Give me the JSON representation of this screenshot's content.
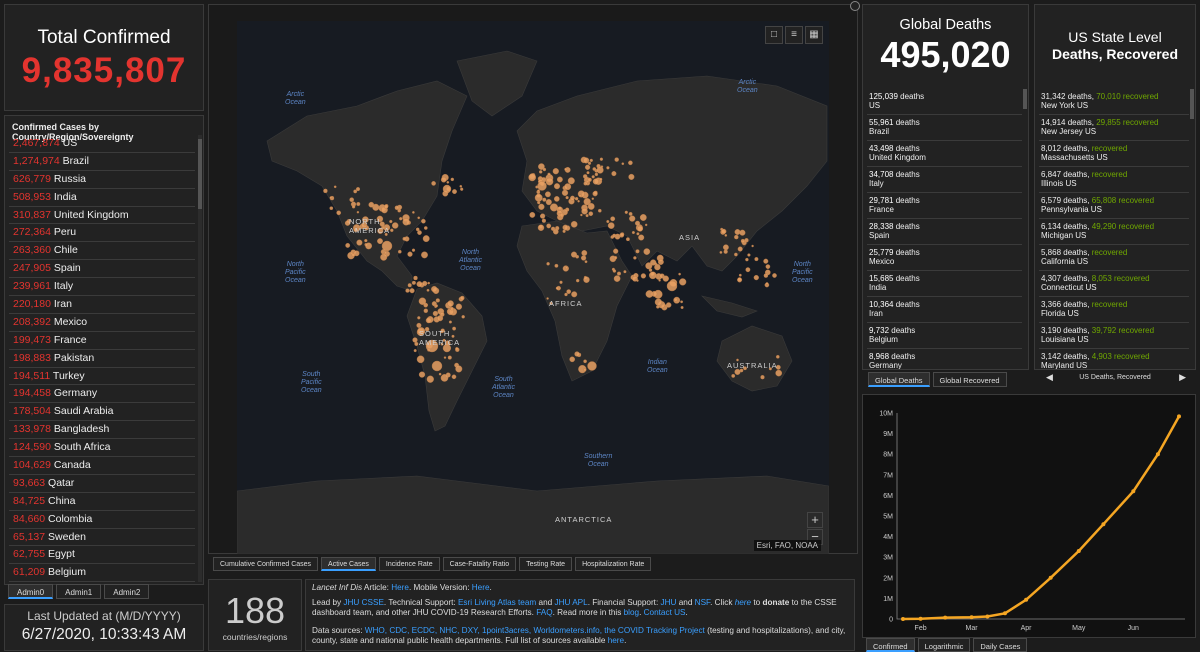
{
  "total": {
    "label": "Total Confirmed",
    "value": "9,835,807"
  },
  "countries": {
    "header": "Confirmed Cases by Country/Region/Sovereignty",
    "items": [
      {
        "count": "2,467,874",
        "name": "US"
      },
      {
        "count": "1,274,974",
        "name": "Brazil"
      },
      {
        "count": "626,779",
        "name": "Russia"
      },
      {
        "count": "508,953",
        "name": "India"
      },
      {
        "count": "310,837",
        "name": "United Kingdom"
      },
      {
        "count": "272,364",
        "name": "Peru"
      },
      {
        "count": "263,360",
        "name": "Chile"
      },
      {
        "count": "247,905",
        "name": "Spain"
      },
      {
        "count": "239,961",
        "name": "Italy"
      },
      {
        "count": "220,180",
        "name": "Iran"
      },
      {
        "count": "208,392",
        "name": "Mexico"
      },
      {
        "count": "199,473",
        "name": "France"
      },
      {
        "count": "198,883",
        "name": "Pakistan"
      },
      {
        "count": "194,511",
        "name": "Turkey"
      },
      {
        "count": "194,458",
        "name": "Germany"
      },
      {
        "count": "178,504",
        "name": "Saudi Arabia"
      },
      {
        "count": "133,978",
        "name": "Bangladesh"
      },
      {
        "count": "124,590",
        "name": "South Africa"
      },
      {
        "count": "104,629",
        "name": "Canada"
      },
      {
        "count": "93,663",
        "name": "Qatar"
      },
      {
        "count": "84,725",
        "name": "China"
      },
      {
        "count": "84,660",
        "name": "Colombia"
      },
      {
        "count": "65,137",
        "name": "Sweden"
      },
      {
        "count": "62,755",
        "name": "Egypt"
      },
      {
        "count": "61,209",
        "name": "Belgium"
      }
    ]
  },
  "admin_tabs": [
    "Admin0",
    "Admin1",
    "Admin2"
  ],
  "updated": {
    "label": "Last Updated at (M/D/YYYY)",
    "value": "6/27/2020, 10:33:43 AM"
  },
  "map": {
    "oceans": [
      {
        "text": "Arctic\nOcean"
      },
      {
        "text": "Arctic\nOcean"
      },
      {
        "text": "North\nPacific\nOcean"
      },
      {
        "text": "North\nAtlantic\nOcean"
      },
      {
        "text": "North\nPacific\nOcean"
      },
      {
        "text": "South\nPacific\nOcean"
      },
      {
        "text": "South\nAtlantic\nOcean"
      },
      {
        "text": "Indian\nOcean"
      },
      {
        "text": "Southern\nOcean"
      }
    ],
    "continents": [
      "NORTH\nAMERICA",
      "SOUTH\nAMERICA",
      "AFRICA",
      "ASIA",
      "AUSTRALIA",
      "ANTARCTICA"
    ],
    "attribution": "Esri, FAO, NOAA",
    "zoom_in": "+",
    "zoom_out": "−"
  },
  "map_tabs": [
    "Cumulative Confirmed Cases",
    "Active Cases",
    "Incidence Rate",
    "Case-Fatality Ratio",
    "Testing Rate",
    "Hospitalization Rate"
  ],
  "regions": {
    "value": "188",
    "label": "countries/regions"
  },
  "info": {
    "l1a": "Lancet Inf Dis",
    "l1b": " Article: ",
    "l1c": "Here",
    "l1d": ". Mobile Version: ",
    "l1e": "Here",
    "l1f": ".",
    "l2a": "Lead by ",
    "l2b": "JHU CSSE",
    "l2c": ". Technical Support: ",
    "l2d": "Esri Living Atlas team",
    "l2e": " and ",
    "l2f": "JHU APL",
    "l2g": ". Financial Support: ",
    "l2h": "JHU",
    "l2i": " and ",
    "l2j": "NSF",
    "l2k": ". Click ",
    "l2l": "here",
    "l2m": " to ",
    "l2n": "donate",
    "l2o": " to the CSSE dashboard team, and other JHU COVID-19 Research Efforts. ",
    "l2p": "FAQ",
    "l2q": ". Read more in this ",
    "l2r": "blog",
    "l2s": ". ",
    "l2t": "Contact US",
    "l2u": ".",
    "l3a": "Data sources: ",
    "l3b": "WHO, CDC, ECDC, NHC, DXY, 1point3acres, Worldometers.info, the COVID Tracking Project",
    "l3c": " (testing and hospitalizations), and city, county, state and national public health departments. Full list of sources available ",
    "l3d": "here",
    "l3e": "."
  },
  "global_deaths": {
    "label": "Global Deaths",
    "value": "495,020",
    "unit": "deaths",
    "items": [
      {
        "count": "125,039",
        "name": "US"
      },
      {
        "count": "55,961",
        "name": "Brazil"
      },
      {
        "count": "43,498",
        "name": "United Kingdom"
      },
      {
        "count": "34,708",
        "name": "Italy"
      },
      {
        "count": "29,781",
        "name": "France"
      },
      {
        "count": "28,338",
        "name": "Spain"
      },
      {
        "count": "25,779",
        "name": "Mexico"
      },
      {
        "count": "15,685",
        "name": "India"
      },
      {
        "count": "10,364",
        "name": "Iran"
      },
      {
        "count": "9,732",
        "name": "Belgium"
      },
      {
        "count": "8,968",
        "name": "Germany"
      }
    ]
  },
  "deaths_tabs": [
    "Global Deaths",
    "Global Recovered"
  ],
  "us_state": {
    "title1": "US State Level",
    "title2": "Deaths, Recovered",
    "deaths_word": "deaths,",
    "recovered_word": "recovered",
    "items": [
      {
        "deaths": "31,342",
        "recovered": "70,010",
        "name": "New York US"
      },
      {
        "deaths": "14,914",
        "recovered": "29,855",
        "name": "New Jersey US"
      },
      {
        "deaths": "8,012",
        "recovered": "",
        "name": "Massachusetts US"
      },
      {
        "deaths": "6,847",
        "recovered": "",
        "name": "Illinois US"
      },
      {
        "deaths": "6,579",
        "recovered": "65,808",
        "name": "Pennsylvania US"
      },
      {
        "deaths": "6,134",
        "recovered": "49,290",
        "name": "Michigan US"
      },
      {
        "deaths": "5,868",
        "recovered": "",
        "name": "California US"
      },
      {
        "deaths": "4,307",
        "recovered": "8,053",
        "name": "Connecticut US"
      },
      {
        "deaths": "3,366",
        "recovered": "",
        "name": "Florida US"
      },
      {
        "deaths": "3,190",
        "recovered": "39,792",
        "name": "Louisiana US"
      },
      {
        "deaths": "3,142",
        "recovered": "4,903",
        "name": "Maryland US"
      }
    ],
    "nav_label": "US Deaths, Recovered",
    "prev": "◀",
    "next": "▶"
  },
  "chart_tabs": [
    "Confirmed",
    "Logarithmic",
    "Daily Cases"
  ],
  "colors": {
    "confirmed_red": "#e3342f",
    "recovered_green": "#70a800",
    "link_blue": "#3a9fff",
    "bubble_orange": "#e8a063",
    "curve_orange": "#f5a623"
  },
  "chart_data": {
    "type": "line",
    "title": "",
    "xlabel": "",
    "ylabel": "",
    "x_ticks": [
      "Feb",
      "Mar",
      "Apr",
      "May",
      "Jun"
    ],
    "y_ticks": [
      "0",
      "1M",
      "2M",
      "3M",
      "4M",
      "5M",
      "6M",
      "7M",
      "8M",
      "9M",
      "10M"
    ],
    "ylim": [
      0,
      10000000
    ],
    "x": [
      "Jan 22",
      "Feb 1",
      "Feb 15",
      "Mar 1",
      "Mar 10",
      "Mar 20",
      "Apr 1",
      "Apr 15",
      "May 1",
      "May 15",
      "Jun 1",
      "Jun 15",
      "Jun 27"
    ],
    "values": [
      555,
      12000,
      69000,
      88000,
      120000,
      275000,
      930000,
      2000000,
      3300000,
      4600000,
      6200000,
      8000000,
      9835807
    ]
  }
}
